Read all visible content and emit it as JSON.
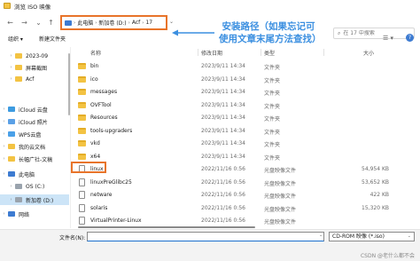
{
  "window": {
    "title": "浏览 ISO 映像"
  },
  "nav": {
    "back_glyph": "←",
    "forward_glyph": "→",
    "up_glyph": "↑"
  },
  "address": {
    "crumbs": [
      "此电脑",
      "新加卷 (D:)",
      "Acf",
      "17"
    ],
    "separator": "›",
    "annotation": "安装路径（如果忘记可使用文章末尾方法查找）"
  },
  "search": {
    "placeholder": "在 17 中搜索"
  },
  "toolbar": {
    "organize": "组织 ▾",
    "new_folder": "新建文件夹",
    "view_glyph": "☰ ▾",
    "help_glyph": "?"
  },
  "sidebar": {
    "items": [
      {
        "label": "2023-09",
        "icon": "folder-icon",
        "color": "#f3c343",
        "indent": 1
      },
      {
        "label": "屏幕截图",
        "icon": "folder-icon",
        "color": "#f3c343",
        "indent": 1
      },
      {
        "label": "Acf",
        "icon": "folder-icon",
        "color": "#f3c343",
        "indent": 1
      },
      {
        "label": "iCloud 云盘",
        "icon": "cloud-icon",
        "color": "#3d9be0",
        "indent": 0
      },
      {
        "label": "iCloud 照片",
        "icon": "photos-icon",
        "color": "#5aa0e6",
        "indent": 0
      },
      {
        "label": "WPS云盘",
        "icon": "cloud-icon",
        "color": "#4aa0e8",
        "indent": 0
      },
      {
        "label": "我的云文档",
        "icon": "folder-icon",
        "color": "#f3c343",
        "indent": 0
      },
      {
        "label": "长幅广社-文稿",
        "icon": "folder-icon",
        "color": "#f3c343",
        "indent": 0
      },
      {
        "label": "此电脑",
        "icon": "computer-icon",
        "color": "#3d7bd1",
        "indent": 0
      },
      {
        "label": "OS (C:)",
        "icon": "drive-icon",
        "color": "#9aa3ad",
        "indent": 1
      },
      {
        "label": "新加卷 (D:)",
        "icon": "drive-icon",
        "color": "#9aa3ad",
        "indent": 1
      },
      {
        "label": "网络",
        "icon": "network-icon",
        "color": "#3d7bd1",
        "indent": 0
      }
    ]
  },
  "columns": {
    "name": "名称",
    "date": "修改日期",
    "type": "类型",
    "size": "大小"
  },
  "files": [
    {
      "name": "bin",
      "date": "2023/9/11 14:34",
      "type": "文件夹",
      "size": "",
      "kind": "folder"
    },
    {
      "name": "ico",
      "date": "2023/9/11 14:34",
      "type": "文件夹",
      "size": "",
      "kind": "folder"
    },
    {
      "name": "messages",
      "date": "2023/9/11 14:34",
      "type": "文件夹",
      "size": "",
      "kind": "folder"
    },
    {
      "name": "OVFTool",
      "date": "2023/9/11 14:34",
      "type": "文件夹",
      "size": "",
      "kind": "folder"
    },
    {
      "name": "Resources",
      "date": "2023/9/11 14:34",
      "type": "文件夹",
      "size": "",
      "kind": "folder"
    },
    {
      "name": "tools-upgraders",
      "date": "2023/9/11 14:34",
      "type": "文件夹",
      "size": "",
      "kind": "folder"
    },
    {
      "name": "vkd",
      "date": "2023/9/11 14:34",
      "type": "文件夹",
      "size": "",
      "kind": "folder"
    },
    {
      "name": "x64",
      "date": "2023/9/11 14:34",
      "type": "文件夹",
      "size": "",
      "kind": "folder"
    },
    {
      "name": "linux",
      "date": "2022/11/16 0:56",
      "type": "光盘映像文件",
      "size": "54,954 KB",
      "kind": "file"
    },
    {
      "name": "linuxPreGlibc25",
      "date": "2022/11/16 0:56",
      "type": "光盘映像文件",
      "size": "53,652 KB",
      "kind": "file"
    },
    {
      "name": "netware",
      "date": "2022/11/16 0:56",
      "type": "光盘映像文件",
      "size": "422 KB",
      "kind": "file"
    },
    {
      "name": "solaris",
      "date": "2022/11/16 0:56",
      "type": "光盘映像文件",
      "size": "15,320 KB",
      "kind": "file"
    },
    {
      "name": "VirtualPrinter-Linux",
      "date": "2022/11/16 0:56",
      "type": "光盘映像文件",
      "size": "",
      "kind": "file"
    }
  ],
  "bottom": {
    "filename_label": "文件名(N):",
    "filename_value": "",
    "filter_value": "CD-ROM 映像 (*.iso)",
    "watermark": "CSDN @老什么都不会"
  },
  "colors": {
    "highlight": "#e8742a",
    "annotation": "#3b8fe0",
    "selected_row": "#cce4f7"
  }
}
